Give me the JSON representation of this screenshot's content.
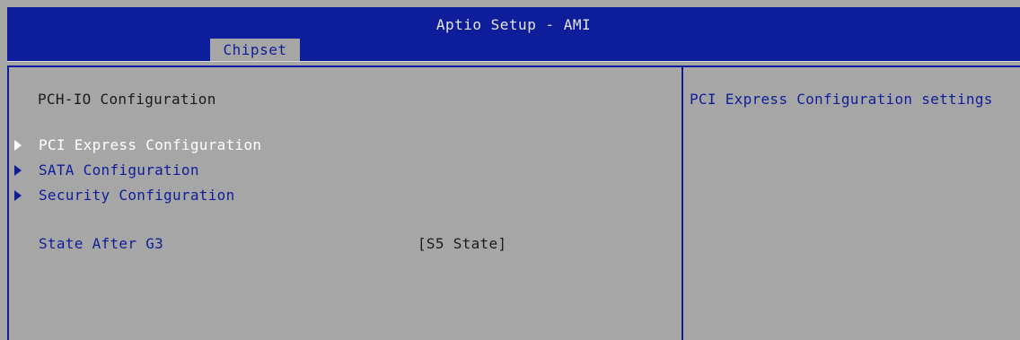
{
  "header": {
    "title": "Aptio Setup - AMI",
    "active_tab": "Chipset"
  },
  "main": {
    "section_title": "PCH-IO Configuration",
    "menu_items": [
      {
        "label": "PCI Express Configuration",
        "selected": true
      },
      {
        "label": "SATA Configuration",
        "selected": false
      },
      {
        "label": "Security Configuration",
        "selected": false
      }
    ],
    "settings": [
      {
        "label": "State After G3",
        "value": "[S5 State]"
      }
    ]
  },
  "help": {
    "text": "PCI Express Configuration settings"
  },
  "colors": {
    "header_bg": "#0e1e9a",
    "panel_bg": "#a6a6a6",
    "accent": "#0e1e9a",
    "selected_text": "#ffffff"
  }
}
